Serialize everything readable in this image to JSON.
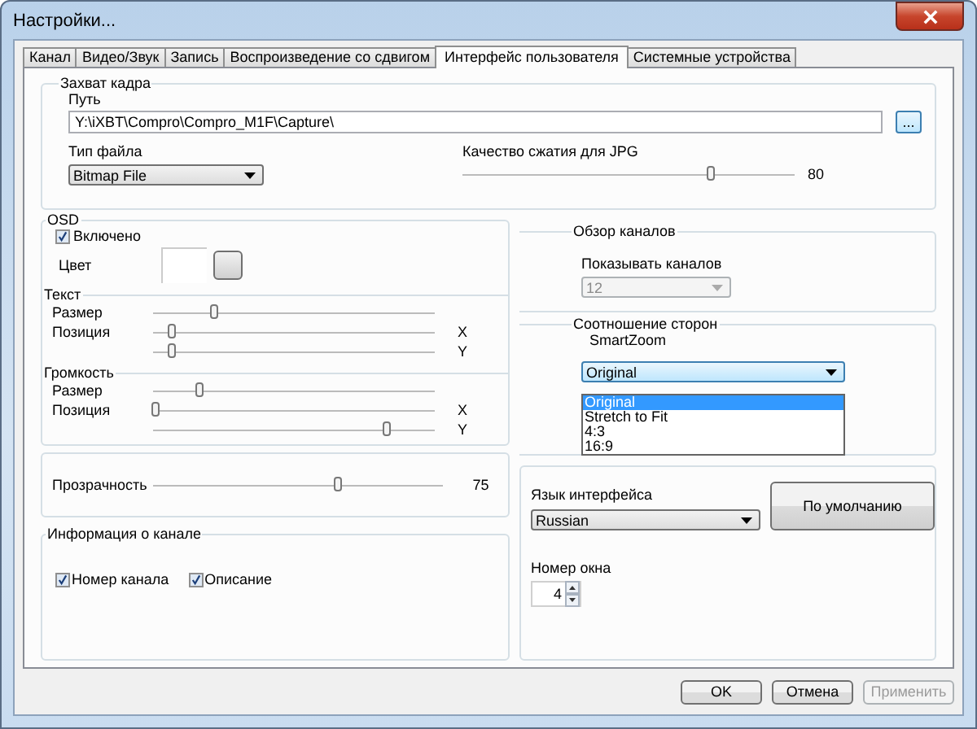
{
  "window": {
    "title": "Настройки..."
  },
  "tabs": [
    {
      "label": "Канал",
      "selected": false
    },
    {
      "label": "Видео/Звук",
      "selected": false
    },
    {
      "label": "Запись",
      "selected": false
    },
    {
      "label": "Воспроизведение со сдвигом",
      "selected": false
    },
    {
      "label": "Интерфейс пользователя",
      "selected": true
    },
    {
      "label": "Системные устройства",
      "selected": false
    }
  ],
  "frame_capture": {
    "title": "Захват кадра",
    "path_label": "Путь",
    "path_value": "Y:\\iXBT\\Compro\\Compro_M1F\\Capture\\",
    "browse_button": "...",
    "file_type_label": "Тип файла",
    "file_type_value": "Bitmap File",
    "jpg_quality": {
      "label": "Качество сжатия для JPG",
      "level": 0.75,
      "reading": "80"
    }
  },
  "osd": {
    "title": "OSD",
    "enabled": {
      "label": "Включено",
      "checked": true
    },
    "color_label": "Цвет",
    "text": {
      "title": "Текст",
      "sliders": [
        {
          "label": "Размер",
          "level": 0.22
        },
        {
          "label": "Позиция",
          "level": 0.07,
          "axis": "X"
        },
        {
          "axis": "Y",
          "level": 0.07
        }
      ]
    },
    "volume": {
      "title": "Громкость",
      "sliders": [
        {
          "label": "Размер",
          "level": 0.17
        },
        {
          "label": "Позиция",
          "level": 0.01,
          "axis": "X"
        },
        {
          "axis": "Y",
          "level": 0.83
        }
      ]
    }
  },
  "transparency": {
    "label": "Прозрачность",
    "level": 0.64,
    "reading": "75"
  },
  "channel_info": {
    "title": "Информация о канале",
    "checkboxes": [
      {
        "label": "Номер канала",
        "checked": true
      },
      {
        "label": "Описание",
        "checked": true
      }
    ]
  },
  "channel_overview": {
    "title": "Обзор каналов",
    "label": "Показывать каналов",
    "value": "12",
    "disabled": true
  },
  "aspect": {
    "title": "Соотношение сторон",
    "label": "SmartZoom",
    "value": "Original",
    "options": [
      {
        "label": "Original",
        "selected": true
      },
      {
        "label": "Stretch to Fit",
        "selected": false
      },
      {
        "label": "4:3",
        "selected": false
      },
      {
        "label": "16:9",
        "selected": false
      }
    ]
  },
  "language": {
    "label": "Язык интерфейса",
    "value": "Russian"
  },
  "default_button": "По умолчанию",
  "window_number": {
    "label": "Номер окна",
    "value": "4"
  },
  "buttons": [
    {
      "label": "OK",
      "disabled": false
    },
    {
      "label": "Отмена",
      "disabled": false
    },
    {
      "label": "Применить",
      "disabled": true
    }
  ]
}
